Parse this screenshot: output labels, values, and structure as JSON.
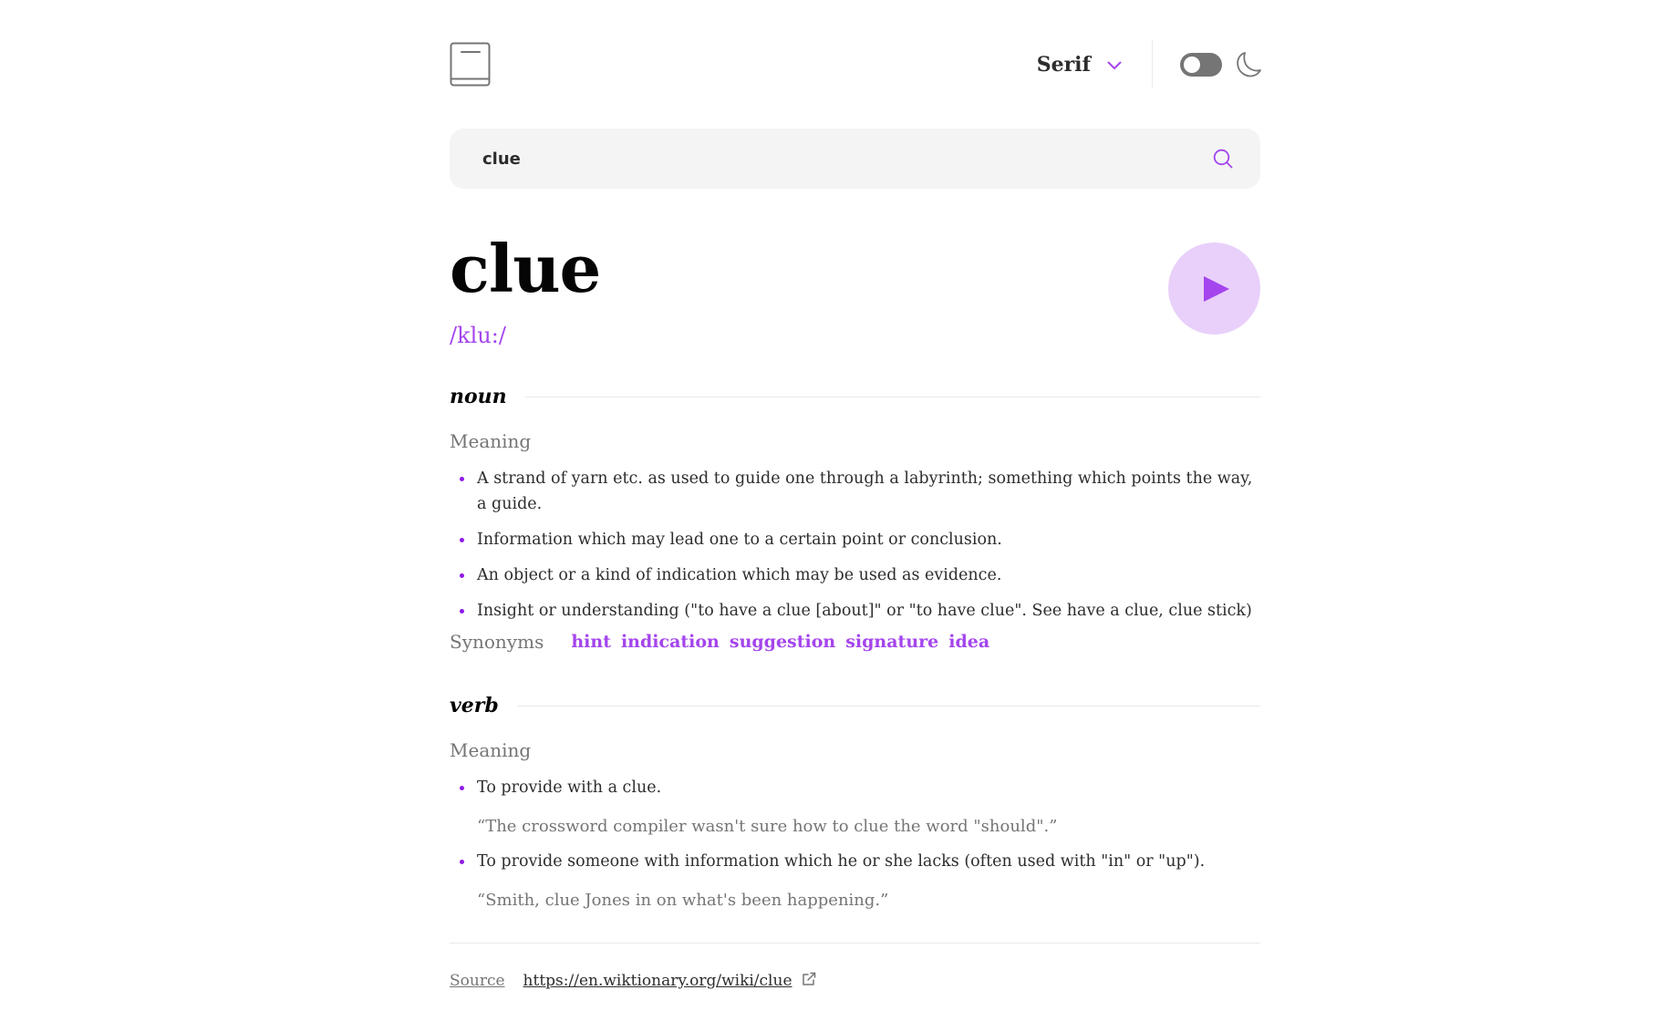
{
  "header": {
    "font_select": {
      "selected": "Serif"
    },
    "theme": {
      "dark_mode": false
    }
  },
  "search": {
    "value": "clue",
    "placeholder": ""
  },
  "entry": {
    "word": "clue",
    "phonetic": "/klu:/"
  },
  "meanings": [
    {
      "part_of_speech": "noun",
      "meaning_label": "Meaning",
      "definitions": [
        {
          "text": "A strand of yarn etc. as used to guide one through a labyrinth; something which points the way, a guide."
        },
        {
          "text": "Information which may lead one to a certain point or conclusion."
        },
        {
          "text": "An object or a kind of indication which may be used as evidence."
        },
        {
          "text": "Insight or understanding (\"to have a clue [about]\" or \"to have clue\". See have a clue, clue stick)"
        }
      ],
      "synonyms_label": "Synonyms",
      "synonyms": [
        "hint",
        "indication",
        "suggestion",
        "signature",
        "idea"
      ]
    },
    {
      "part_of_speech": "verb",
      "meaning_label": "Meaning",
      "definitions": [
        {
          "text": "To provide with a clue.",
          "example": "“The crossword compiler wasn't sure how to clue the word \"should\".”"
        },
        {
          "text": "To provide someone with information which he or she lacks (often used with \"in\" or \"up\").",
          "example": "“Smith, clue Jones in on what's been happening.”"
        }
      ]
    }
  ],
  "footer": {
    "source_label": "Source",
    "source_url": "https://en.wiktionary.org/wiki/clue"
  },
  "colors": {
    "accent": "#a445ed",
    "play_bg": "#e9d0fa",
    "muted": "#757575"
  }
}
